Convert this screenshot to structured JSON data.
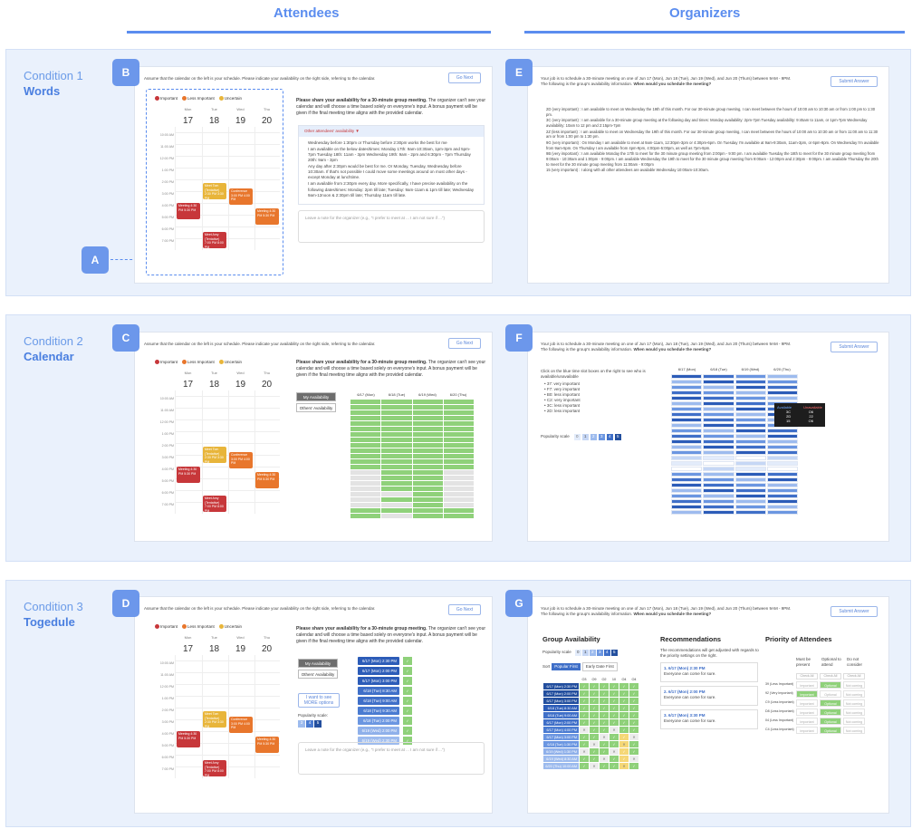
{
  "headers": {
    "attendees": "Attendees",
    "organizers": "Organizers"
  },
  "conditions": [
    {
      "label": "Condition 1",
      "name": "Words"
    },
    {
      "label": "Condition 2",
      "name": "Calendar"
    },
    {
      "label": "Condition 3",
      "name": "Togedule"
    }
  ],
  "badges": {
    "a": "A",
    "b": "B",
    "c": "C",
    "d": "D",
    "e": "E",
    "f": "F",
    "g": "G"
  },
  "attendee": {
    "instruction": "Assume that the calendar on the left is your schedule. Please indicate your availability on the right side, referring to the calendar.",
    "go_next": "Go Next",
    "share_title": "Please share your availability for a 30-minute group meeting.",
    "share_body": "The organizer can't see your calendar and will choose a time based solely on everyone's input. A bonus payment will be given if the final meeting time aligns with the provided calendar.",
    "legend": [
      "Important",
      "Less Important",
      "Uncertain"
    ],
    "legend_colors": [
      "#c7373a",
      "#e8762c",
      "#e8b53a"
    ],
    "days": [
      {
        "n": "Mon",
        "d": "17"
      },
      {
        "n": "Tue",
        "d": "18"
      },
      {
        "n": "Wed",
        "d": "19"
      },
      {
        "n": "Thu",
        "d": "20"
      }
    ],
    "times": [
      "10:00 AM",
      "11:00 AM",
      "12:00 PM",
      "1:00 PM",
      "2:00 PM",
      "3:00 PM",
      "4:00 PM",
      "5:00 PM",
      "6:00 PM",
      "7:00 PM",
      "8:00 PM"
    ],
    "events": {
      "meet_tom": "Meet Tom (Tentative) 2:30 PM 3:30 PM",
      "conference": "Conference 3:00 PM 4:00 PM",
      "meeting_mon": "Meeting 4:30 PM 5:30 PM",
      "meeting_thu": "Meeting 4:30 PM 5:30 PM",
      "meet_amy": "Meet Amy (Tentative) 7:00 PM 8:00 PM"
    },
    "other_avail_title": "Other attendees' availability",
    "other_avail_items": [
      "Wednesday before 1:30pm or Thursday before 2:30pm works the best for me",
      "I am available on the below dates/times: Monday 17th: 9am-10:30am, 1pm-3pm and 5pm-7pm Tuesday 18th: 11am - 3pm Wednesday 19th: 9am - 2pm and 6:30pm - 7pm Thursday 20th: 9am - 3pm",
      "Any day after 2:30pm would be best for me. Or Monday, Tuesday, Wednesday before 10:30am. If that's not possible I could move some meetings around on most other days - except Monday at lunchtime.",
      "I am available from 2:30pm every day. More specifically, I have precise availability on the following dates/times: Monday: 2pm till late; Tuesday: 9am-11am & 1pm till late; Wednesday 9am-12noon & 2:30pm till late; Thursday 11am till late."
    ],
    "note_placeholder": "Leave a note for the organizer (e.g., \"I prefer to meet at ... I am not sure if ...\")",
    "my_availability": "My Availability",
    "others_availability": "Others' Availability",
    "col_headers": [
      "6/17 (Mon)",
      "6/18 (Tue)",
      "6/19 (Wed)",
      "6/20 (Thu)"
    ],
    "see_more": "I want to see MORE options",
    "popularity_scale": "Popularity scale:",
    "scale_values": [
      "3",
      "4",
      "5"
    ],
    "slots": [
      "6/17 (Mon) 2:30 PM",
      "6/17 (Mon) 2:00 PM",
      "6/17 (Mon) 3:00 PM",
      "6/18 (Tue) 8:30 AM",
      "6/18 (Tue) 9:00 AM",
      "6/18 (Tue) 9:30 AM",
      "6/18 (Tue) 2:00 PM",
      "6/19 (Wed) 2:00 PM",
      "6/19 (Wed) 2:30 PM"
    ]
  },
  "organizer": {
    "instruction": "Your job is to schedule a 30-minute meeting on one of Jun 17 (Mon), Jun 18 (Tue), Jun 19 (Wed), and Jun 20 (Thurs) between 9AM - 9PM.",
    "instruction2": "The following is the group's availability information.",
    "question": "When would you schedule the meeting?",
    "submit": "Submit Answer",
    "words": [
      "2D (very important) : I am available to meet on Wednesday the 19th of this month. For our 30-minute group meeting, I can meet between the hours of 10:00 am to 10:30 am or from 1:00 pm to 1:30 pm.",
      "3C (very important) : I am available for a 30-minute group meeting at the following day and times: Monday availability: 2pm-7pm Tuesday availability: 9:45am to 11am, or 1pm-7pm Wednesday availability: 10am to 12 pm and 2:15pm-7pm",
      "2Z (less important) : I am available to meet on Wednesday the 19th of this month. For our 30-minute group meeting, I can meet between the hours of 10:00 am to 10:30 am or from 11:00 am to 11:30 am or from 1:00 pm to 1:30 pm.",
      "9G (very important) : On Monday I am available to meet at 9am-11am, 12:30pm-3pm or 4:30pm-6pm. On Tuesday I'm available at 9am-9:30am, 11am-3pm, or 6pm-8pm. On Wednesday I'm available from 9am-5pm. On Thursday I am available from 4pm-9pm, 4:00pm-5:00pm, as well as 7pm-9pm.",
      "9B (very important) : I am available Monday the 17th to meet for the 30 minute group meeting from 2:00pm - 9:00 pm. I am available Tuesday the 18th to meet for the 30 minute group meeting from 9:00am - 10:30am and 1:00pm - 9:00pm. I am available Wednesday the 19th to meet for the 30 minute group meeting from 9:00am - 12:00pm and 2:30pm - 9:00pm. I am available Thursday the 20th to meet for the 30 minute group meeting from 11:00am - 9:00pm",
      "15 (very important) : I along with all other attendees are available Wednesday 10:00am-10:30am."
    ],
    "calendar_instr": "Click on the blue time slot boxes on the right to see who is available/unavailable",
    "attendee_list": [
      "37: very important",
      "F7: very important",
      "B0: less important",
      "C2: very important",
      "3C: less important",
      "2D: less important"
    ],
    "popularity_scale": "Popularity scale",
    "scale_values": [
      "0",
      "1",
      "2",
      "3",
      "4",
      "5"
    ],
    "heat_cols": [
      "6/17 (Mon)",
      "6/18 (Tue)",
      "6/19 (Wed)",
      "6/20 (Thu)"
    ],
    "tooltip": {
      "available": "Available",
      "unavailable": "Unavailable",
      "rows": [
        [
          "3C",
          "O6"
        ],
        [
          "2D",
          "22"
        ],
        [
          "15",
          "O6"
        ]
      ]
    },
    "group_avail": "Group Availability",
    "sort": "Sort",
    "popular_first": "Popular First",
    "early_date_first": "Early Date First",
    "ga_cols": [
      "O3",
      "O9",
      "O2",
      "10",
      "O4",
      "O4"
    ],
    "ga_rows": [
      "6/17 (Mon) 2:30 PM",
      "6/17 (Mon) 2:00 PM",
      "6/17 (Mon) 3:00 PM",
      "6/18 (Tue) 8:30 AM",
      "6/18 (Tue) 9:00 AM",
      "6/17 (Mon) 2:00 PM",
      "6/17 (Mon) 4:00 PM",
      "6/17 (Mon) 3:00 PM",
      "6/18 (Tue) 1:30 PM",
      "6/19 (Wed) 1:30 PM",
      "6/19 (Wed) 8:30 AM",
      "6/20 (Thu) 10:00 AM"
    ],
    "recommendations": "Recommendations",
    "rec_note": "The recommendations will get adjusted with regards to the priority settings on the right.",
    "recs": [
      {
        "t": "1. 6/17 (Mon) 2:30 PM",
        "s": "Everyone can come for sure."
      },
      {
        "t": "2. 6/17 (Mon) 2:00 PM",
        "s": "Everyone can come for sure."
      },
      {
        "t": "3. 6/17 (Mon) 3:30 PM",
        "s": "Everyone can come for sure."
      }
    ],
    "priority": "Priority of Attendees",
    "prio_cols": [
      "Must be present",
      "Optional to attend",
      "Do not consider"
    ],
    "check_all": "Check All",
    "prio_rows": [
      "39 (Less Important)",
      "92 (Very Important)",
      "C9 (Less Important)",
      "D8 (Less Important)",
      "04 (Less Important)",
      "C4 (Less Important)"
    ],
    "prio_labels": {
      "important": "Important",
      "optional": "Optional",
      "not": "Not coming"
    }
  },
  "colors": {
    "accent": "#5b8def",
    "band": "#eaf1fc",
    "green": "#8fd17a",
    "heat_dark": "#2c5cb8"
  }
}
